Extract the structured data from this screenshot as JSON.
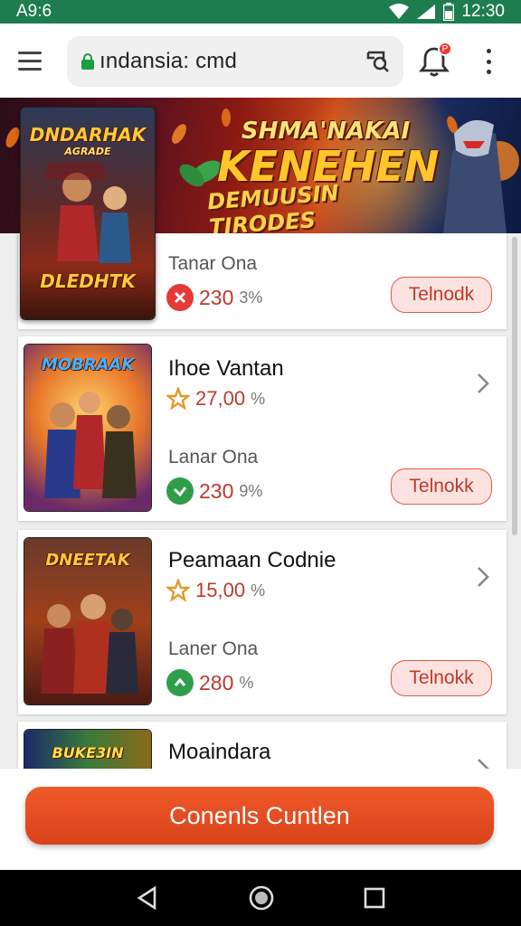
{
  "status_bar": {
    "time_left": "A9:6",
    "time_right": "12:30"
  },
  "browser": {
    "url": "ındansia: cmd"
  },
  "banner": {
    "line1": "SHMA'NAKAI",
    "line2": "KENEHEN",
    "line3": "DEMUUSIN TIRODES",
    "poster_top": "DNDARHAK",
    "poster_sub": "AGRADE",
    "poster_bottom": "DLEDHTK"
  },
  "items": [
    {
      "title": "",
      "sub_label": "Tanar Ona",
      "price": "230",
      "price_suffix": "3%",
      "cta": "Telnodk",
      "price_icon_color": "#e53935",
      "logo": ""
    },
    {
      "title": "Ihoe Vantan",
      "rating": "27,00",
      "rating_suffix": "%",
      "sub_label": "Lanar Ona",
      "price": "230",
      "price_suffix": "9%",
      "cta": "Telnokk",
      "price_icon_color": "#2e9e4a",
      "logo": "MOBRAAK"
    },
    {
      "title": "Peamaan Codnie",
      "rating": "15,00",
      "rating_suffix": "%",
      "sub_label": "Laner Ona",
      "price": "280",
      "price_suffix": "%",
      "cta": "Telnokk",
      "price_icon_color": "#2e9e4a",
      "logo": "DNEETAK"
    },
    {
      "title": "Moaindara",
      "logo": "BUKE3IN"
    }
  ],
  "bottom_button": {
    "label": "Conenls Cuntlen"
  },
  "colors": {
    "status_bar": "#1e7d4f",
    "accent": "#e04a20",
    "rating_star": "#e39a2a"
  }
}
